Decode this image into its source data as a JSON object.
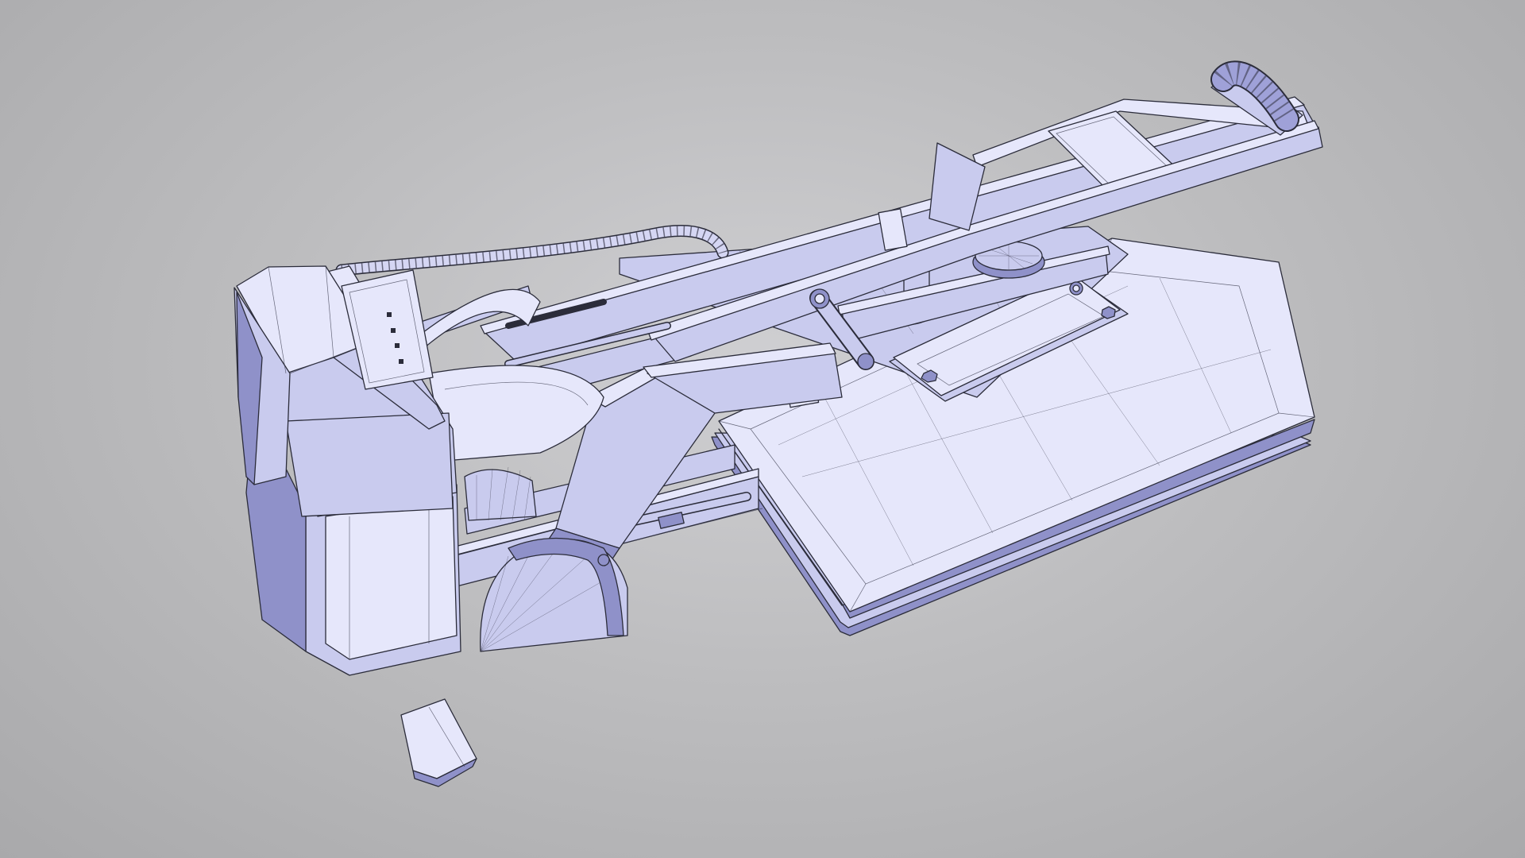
{
  "scene": {
    "subject": "heat-press-wireframe-render",
    "colors": {
      "background": "#bdbdbf",
      "material": "#c9cbee",
      "highlight": "#e6e7fb",
      "shadow": "#8f91c9",
      "wire": "#2b2c3a"
    }
  }
}
